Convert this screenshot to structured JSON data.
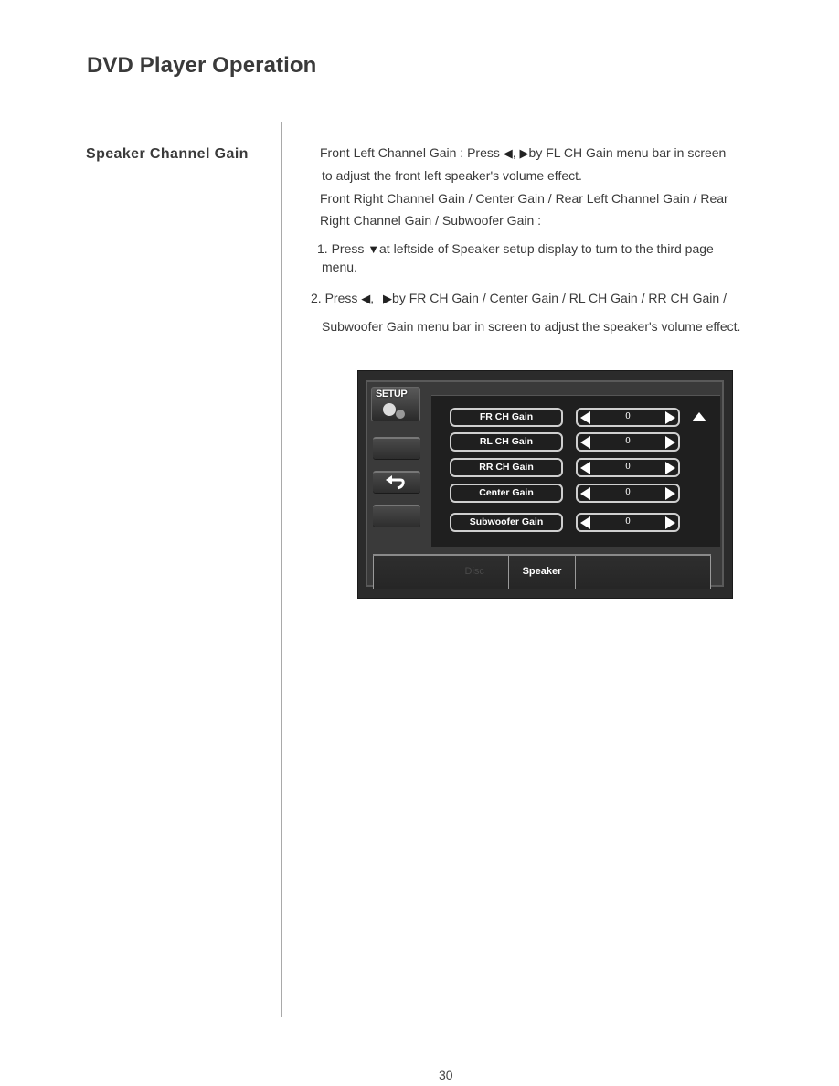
{
  "page": {
    "title": "DVD Player Operation",
    "section_title": "Speaker Channel Gain",
    "page_number": "30"
  },
  "body": {
    "p1_a": "Front Left Channel Gain : Press",
    "p1_b": "by FL CH Gain menu bar in screen",
    "p1_line2": "to adjust the front left speaker's volume effect.",
    "p2_line1": "Front Right Channel Gain / Center Gain / Rear Left Channel Gain / Rear",
    "p2_line2": "Right Channel Gain / Subwoofer Gain :",
    "step1_a": "1. Press",
    "step1_b": "at leftside of Speaker setup display to turn to the third page",
    "step1_line2": "menu.",
    "step2_a": "2. Press",
    "step2_b": "by FR CH Gain / Center Gain / RL CH Gain / RR CH Gain /",
    "step2_line2": "Subwoofer Gain menu bar in screen to adjust the speaker's volume effect.",
    "glyph_left": "◀",
    "glyph_right": "▶",
    "glyph_down": "▼",
    "comma": ","
  },
  "screen": {
    "setup_label": "SETUP",
    "setup_icon": "gear-icon",
    "back_icon": "return-arrow-icon",
    "scroll_up_icon": "up-triangle-icon",
    "gains": [
      {
        "label": "FR CH Gain",
        "value": "0"
      },
      {
        "label": "RL CH Gain",
        "value": "0"
      },
      {
        "label": "RR CH Gain",
        "value": "0"
      },
      {
        "label": "Center Gain",
        "value": "0"
      },
      {
        "label": "Subwoofer Gain",
        "value": "0"
      }
    ],
    "tabs": [
      {
        "label": ""
      },
      {
        "label": "Disc"
      },
      {
        "label": "Speaker"
      },
      {
        "label": ""
      },
      {
        "label": ""
      }
    ]
  }
}
